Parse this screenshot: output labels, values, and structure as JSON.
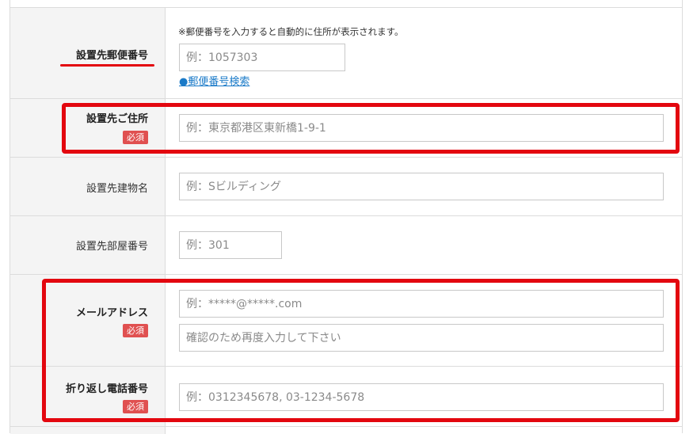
{
  "postal": {
    "label": "設置先郵便番号",
    "note": "※郵便番号を入力すると自動的に住所が表示されます。",
    "placeholder": "例：1057303",
    "search_link": "●郵便番号検索"
  },
  "address": {
    "label": "設置先ご住所",
    "badge": "必須",
    "placeholder": "例：東京都港区東新橋1-9-1"
  },
  "building": {
    "label": "設置先建物名",
    "placeholder": "例：Sビルディング"
  },
  "room": {
    "label": "設置先部屋番号",
    "placeholder": "例：301"
  },
  "email": {
    "label": "メールアドレス",
    "badge": "必須",
    "placeholder": "例：*****@*****.com",
    "confirm_placeholder": "確認のため再度入力して下さい"
  },
  "phone": {
    "label": "折り返し電話番号",
    "badge": "必須",
    "placeholder": "例：0312345678, 03-1234-5678"
  },
  "colors": {
    "highlight": "#e3070f",
    "badge": "#e05050",
    "link": "#1a7ac8",
    "label_bg": "#f4f4f4"
  }
}
